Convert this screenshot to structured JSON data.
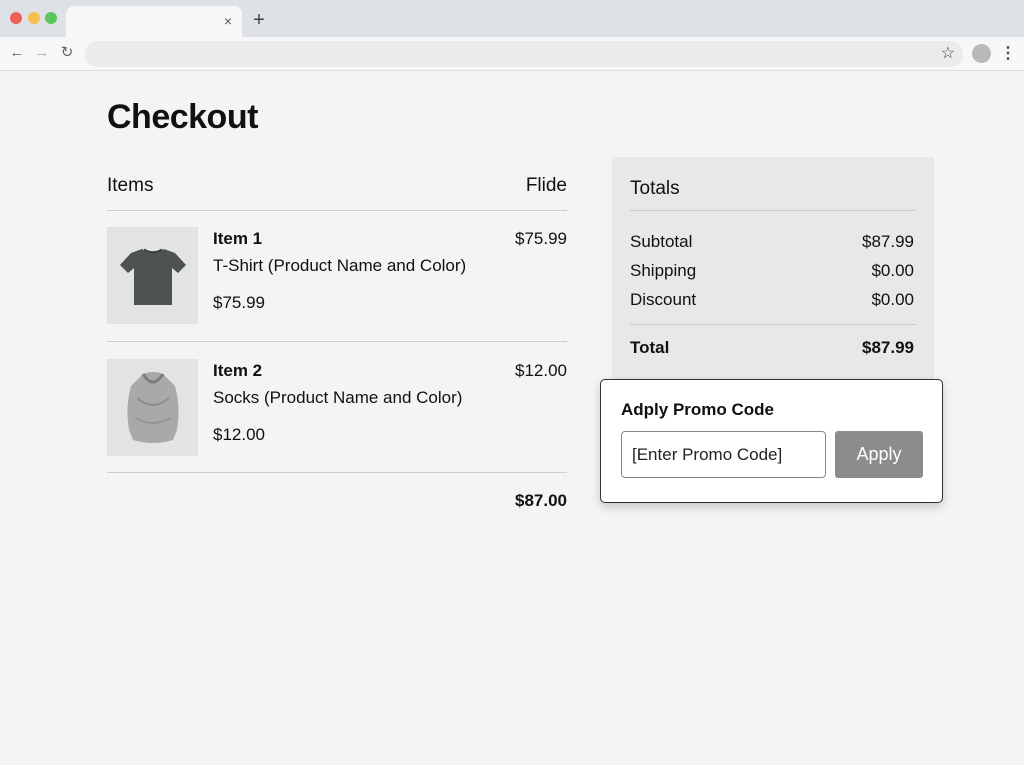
{
  "browser": {
    "tab_close_glyph": "×",
    "new_tab_glyph": "+",
    "back_glyph": "←",
    "forward_glyph": "→",
    "reload_glyph": "↻",
    "star_glyph": "☆",
    "menu_glyph": "⋮"
  },
  "page": {
    "title": "Checkout"
  },
  "items_table": {
    "header_items": "Items",
    "header_price": "Flide",
    "rows": [
      {
        "label": "Item 1",
        "description": "T-Shirt (Product Name and Color)",
        "unit_price": "$75.99",
        "price": "$75.99",
        "image_icon": "tshirt-icon"
      },
      {
        "label": "Item 2",
        "description": "Socks (Product Name and Color)",
        "unit_price": "$12.00",
        "price": "$12.00",
        "image_icon": "sweater-icon"
      }
    ],
    "total": "$87.00"
  },
  "totals": {
    "title": "Totals",
    "subtotal_label": "Subtotal",
    "subtotal_value": "$87.99",
    "shipping_label": "Shipping",
    "shipping_value": "$0.00",
    "discount_label": "Discount",
    "discount_value": "$0.00",
    "total_label": "Total",
    "total_value": "$87.99"
  },
  "promo": {
    "title": "Adply Promo Code",
    "placeholder": "[Enter Promo Code]",
    "button_label": "Apply"
  },
  "colors": {
    "page_bg": "#f4f4f3",
    "panel_bg": "#e8e8e8",
    "apply_button": "#8c8c8c"
  }
}
